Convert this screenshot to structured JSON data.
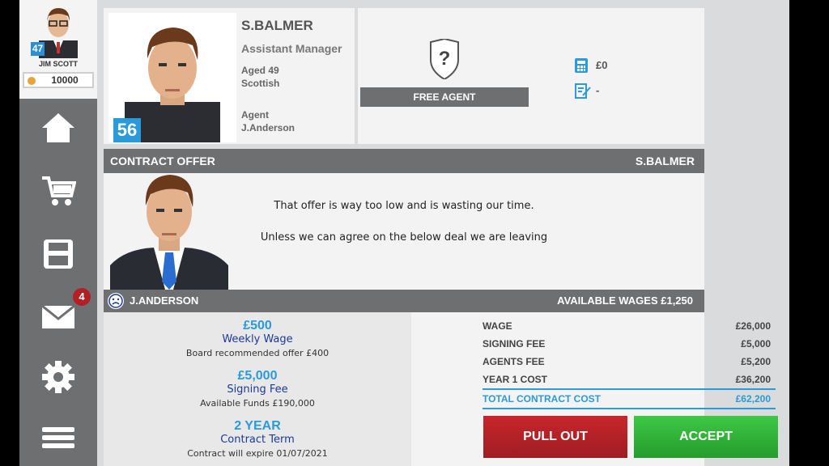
{
  "manager": {
    "name": "JIM SCOTT",
    "level": "47",
    "coins": "10000"
  },
  "nav": {
    "mail_badge": "4"
  },
  "player": {
    "name": "S.BALMER",
    "role": "Assistant Manager",
    "age": "Aged 49",
    "nationality": "Scottish",
    "agent_label": "Agent",
    "agent_name": "J.Anderson",
    "rating": "56"
  },
  "status": {
    "label": "FREE AGENT",
    "value": "£0",
    "contract": "-"
  },
  "contract": {
    "title": "CONTRACT OFFER",
    "player_name": "S.BALMER",
    "message_1": "That offer is way too low and is wasting our time.",
    "message_2": "Unless we can agree on the below deal we are leaving",
    "agent": "J.ANDERSON",
    "available_wages": "AVAILABLE WAGES £1,250",
    "wage_value": "£500",
    "wage_label": "Weekly Wage",
    "wage_note": "Board recommended offer £400",
    "signing_value": "£5,000",
    "signing_label": "Signing Fee",
    "signing_note": "Available Funds £190,000",
    "term_value": "2 YEAR",
    "term_label": "Contract Term",
    "term_note": "Contract will expire 01/07/2021",
    "costs": [
      {
        "label": "WAGE",
        "value": "£26,000"
      },
      {
        "label": "SIGNING FEE",
        "value": "£5,000"
      },
      {
        "label": "AGENTS FEE",
        "value": "£5,200"
      },
      {
        "label": "YEAR 1 COST",
        "value": "£36,200"
      }
    ],
    "total_label": "TOTAL CONTRACT COST",
    "total_value": "£62,200",
    "pull_out": "PULL OUT",
    "accept": "ACCEPT"
  }
}
